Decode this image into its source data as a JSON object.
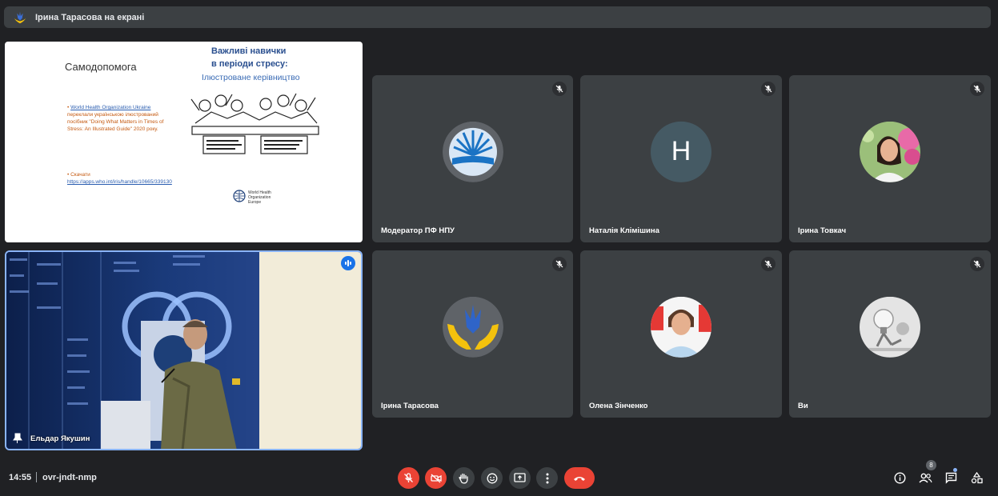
{
  "header": {
    "title": "Ірина Тарасова на екрані"
  },
  "slide": {
    "title": "Самодопомога",
    "heading_line1": "Важливі навички",
    "heading_line2": "в періоди стресу:",
    "heading_line3": "Ілюстроване керівництво",
    "bullet1_link": "World Health Organization Ukraine",
    "bullet1_text": " переклали українською ілюстрований посібник \"Doing What Matters in Times of Stress: An Illustrated Guide\" 2020 року.",
    "bullet2_text": "Скачати ",
    "bullet2_link": "https://apps.who.int/iris/handle/10665/339130",
    "who_line1": "World Health",
    "who_line2": "Organization",
    "who_line3": "Europe"
  },
  "speaker": {
    "name": "Ельдар Якушин"
  },
  "participants": [
    {
      "name": "Модератор ПФ НПУ",
      "avatar": "npu-logo"
    },
    {
      "name": "Наталія Клімішина",
      "initial": "H",
      "avatar_color": "#455a64"
    },
    {
      "name": "Ірина Товкач",
      "avatar": "photo-flowers"
    },
    {
      "name": "Ірина Тарасова",
      "avatar": "trident-hands-logo"
    },
    {
      "name": "Олена Зінченко",
      "avatar": "photo-woman"
    },
    {
      "name": "Ви",
      "avatar": "robot-bulb"
    }
  ],
  "bottom": {
    "time": "14:55",
    "meeting_code": "ovr-jndt-nmp",
    "people_count": "8"
  },
  "colors": {
    "danger": "#ea4335",
    "accent": "#8ab4f8",
    "tile": "#3c4043",
    "bg": "#202124"
  }
}
